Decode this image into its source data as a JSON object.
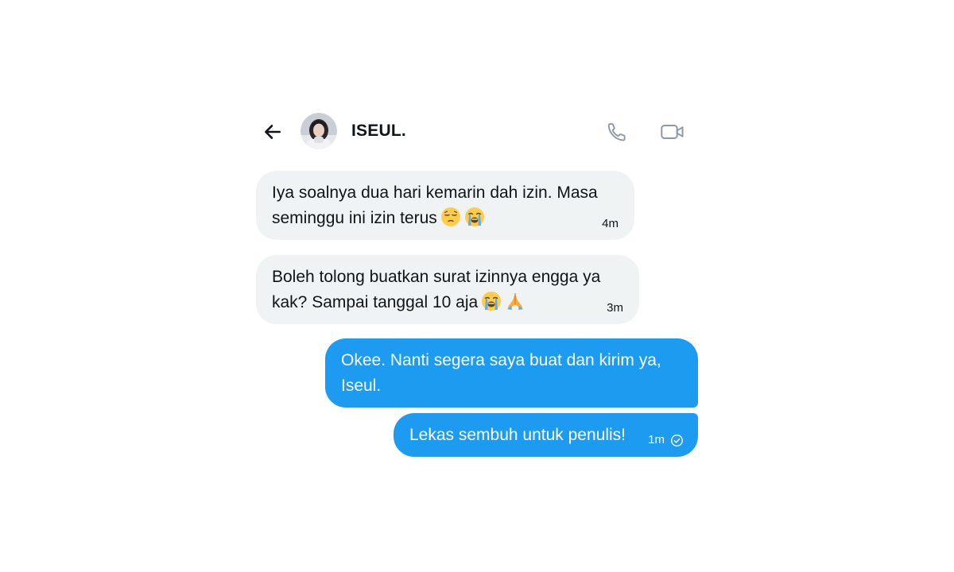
{
  "header": {
    "title": "ISEUL.",
    "back_icon": "arrow-left-icon",
    "call_icon": "phone-icon",
    "video_icon": "video-camera-icon"
  },
  "messages": [
    {
      "direction": "incoming",
      "text_line1": "Iya soalnya dua hari kemarin dah izin. Masa",
      "text_line2": "seminggu ini izin terus",
      "emojis": [
        "pensive-face-emoji",
        "loudly-crying-face-emoji"
      ],
      "time": "4m"
    },
    {
      "direction": "incoming",
      "text_line1": "Boleh tolong buatkan surat izinnya engga ya",
      "text_line2": "kak? Sampai tanggal 10 aja",
      "emojis": [
        "loudly-crying-face-emoji",
        "folded-hands-emoji"
      ],
      "time": "3m"
    },
    {
      "direction": "outgoing",
      "text_line1": "Okee. Nanti segera saya buat dan kirim ya,",
      "text_line2": "Iseul."
    },
    {
      "direction": "outgoing",
      "text_line1": "Lekas sembuh untuk penulis!",
      "time": "1m",
      "status_icon": "seen-check-icon"
    }
  ],
  "colors": {
    "outgoing_bubble": "#1d9bf0",
    "incoming_bubble": "#eff3f4",
    "text": "#0f1419",
    "icon_gray": "#8b98a5"
  }
}
